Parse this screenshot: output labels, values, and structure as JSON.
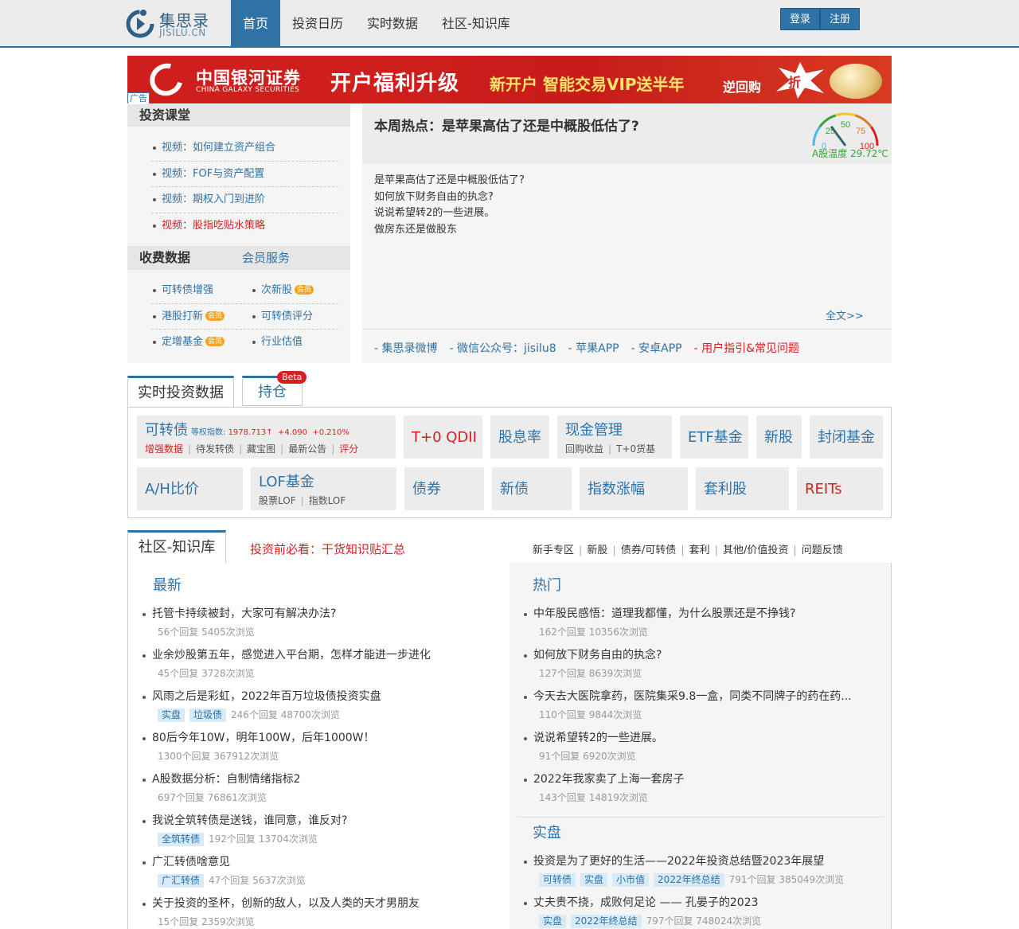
{
  "header": {
    "logo_cn": "集思录",
    "logo_en": "JISILU.CN",
    "nav": [
      "首页",
      "投资日历",
      "实时数据",
      "社区-知识库"
    ],
    "login": "登录",
    "register": "注册"
  },
  "banner": {
    "brand_cn": "中国银河证券",
    "brand_en": "CHINA GALAXY SECURITIES",
    "slogan": "开户福利升级",
    "sub": "新开户 智能交易VIP送半年",
    "tag": "逆回购",
    "burst": "折",
    "ad_label": "广告"
  },
  "course": {
    "title": "投资课堂",
    "items": [
      "视频：如何建立资产组合",
      "视频：FOF与资产配置",
      "视频：期权入门到进阶",
      "视频：股指吃贴水策略"
    ]
  },
  "paid": {
    "title": "收费数据",
    "member": "会员服务",
    "vip_badge": "会员",
    "rows": [
      [
        "可转债增强",
        "次新股"
      ],
      [
        "港股打新",
        "可转债评分"
      ],
      [
        "定增基金",
        "行业估值"
      ]
    ]
  },
  "hot": {
    "title": "本周热点：是苹果高估了还是中概股低估了?",
    "lines": [
      "是苹果高估了还是中概股低估了?",
      "如何放下财务自由的执念?",
      "说说希望转2的一些进展。",
      "做房东还是做股东"
    ],
    "more": "全文>>",
    "gauge_ticks": [
      "0",
      "25",
      "50",
      "75",
      "100"
    ],
    "temperature_label": "A股温度 29.72℃",
    "temperature_value": 29.72,
    "links": [
      "- 集思录微博",
      "- 微信公众号：jisilu8",
      "- 苹果APP",
      "- 安卓APP",
      "- 用户指引&常见问题"
    ]
  },
  "realtime": {
    "tab_active": "实时投资数据",
    "tab_other": "持仓",
    "beta": "Beta",
    "cb": {
      "title": "可转债",
      "index_label": "等权指数:",
      "index_value": "1978.713↑",
      "index_change": "+4.090",
      "index_pct": "+0.210%",
      "subs": [
        "增强数据",
        "待发转债",
        "藏宝图",
        "最新公告",
        "评分"
      ]
    },
    "t0qdii": "T+0 QDII",
    "dividend": "股息率",
    "cash": {
      "title": "现金管理",
      "subs": [
        "回购收益",
        "T+0货基"
      ]
    },
    "etf": "ETF基金",
    "ipo": "新股",
    "closed_fund": "封闭基金",
    "ah": "A/H比价",
    "lof": {
      "title": "LOF基金",
      "subs": [
        "股票LOF",
        "指数LOF"
      ]
    },
    "bond": "债券",
    "new_bond": "新债",
    "index_change": "指数涨幅",
    "arb": "套利股",
    "reits": "REITs"
  },
  "community": {
    "tab": "社区-知识库",
    "must_read": "投资前必看：干货知识贴汇总",
    "categories": [
      "新手专区",
      "新股",
      "债券/可转债",
      "套利",
      "其他/价值投资",
      "问题反馈"
    ],
    "latest_title": "最新",
    "latest": [
      {
        "title": "托管卡持续被封，大家可有解决办法?",
        "tags": [],
        "meta": "56个回复 5405次浏览"
      },
      {
        "title": "业余炒股第五年，感觉进入平台期，怎样才能进一步进化",
        "tags": [],
        "meta": "45个回复 3728次浏览"
      },
      {
        "title": "风雨之后是彩虹，2022年百万垃圾债投资实盘",
        "tags": [
          "实盘",
          "垃圾债"
        ],
        "meta": "246个回复 48700次浏览"
      },
      {
        "title": "80后今年10W，明年100W，后年1000W！",
        "tags": [],
        "meta": "1300个回复 367912次浏览"
      },
      {
        "title": "A股数据分析：自制情绪指标2",
        "tags": [],
        "meta": "697个回复 76861次浏览"
      },
      {
        "title": "我说全筑转债是送钱，谁同意，谁反对?",
        "tags": [
          "全筑转债"
        ],
        "meta": "192个回复 13704次浏览"
      },
      {
        "title": "广汇转债啥意见",
        "tags": [
          "广汇转债"
        ],
        "meta": "47个回复 5637次浏览"
      },
      {
        "title": "关于投资的圣杯，创新的敌人，以及人类的天才男朋友",
        "tags": [],
        "meta": "15个回复 2359次浏览"
      }
    ],
    "hot_title": "热门",
    "hot": [
      {
        "title": "中年股民感悟：道理我都懂，为什么股票还是不挣钱?",
        "tags": [],
        "meta": "162个回复 10356次浏览"
      },
      {
        "title": "如何放下财务自由的执念?",
        "tags": [],
        "meta": "127个回复 8639次浏览"
      },
      {
        "title": "今天去大医院拿药，医院集采9.8一盒，同类不同牌子的药在药...",
        "tags": [],
        "meta": "110个回复 9844次浏览"
      },
      {
        "title": "说说希望转2的一些进展。",
        "tags": [],
        "meta": "91个回复 6920次浏览"
      },
      {
        "title": "2022年我家卖了上海一套房子",
        "tags": [],
        "meta": "143个回复 14819次浏览"
      }
    ],
    "real_title": "实盘",
    "real": [
      {
        "title": "投资是为了更好的生活——2022年投资总结暨2023年展望",
        "tags": [
          "可转债",
          "实盘",
          "小市值",
          "2022年终总结"
        ],
        "meta": "791个回复 385049次浏览"
      },
      {
        "title": "丈夫贵不挠，成败何足论 —— 孔晏子的2023",
        "tags": [
          "实盘",
          "2022年终总结"
        ],
        "meta": "797个回复 748024次浏览"
      }
    ]
  }
}
